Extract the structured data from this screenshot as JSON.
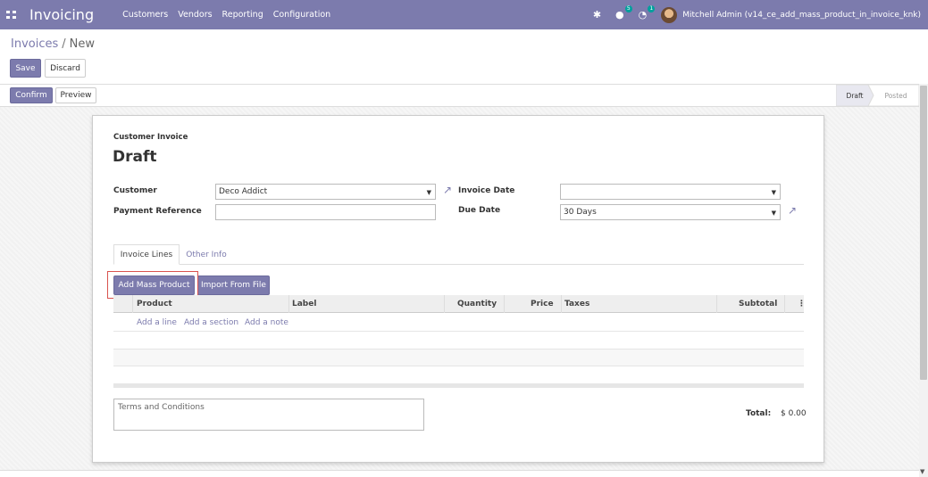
{
  "navbar": {
    "app_title": "Invoicing",
    "menu": [
      "Customers",
      "Vendors",
      "Reporting",
      "Configuration"
    ],
    "icons": [
      "bug-icon",
      "chat-icon",
      "clock-icon"
    ],
    "chat_count": "5",
    "activity_count": "1",
    "user": "Mitchell Admin (v14_ce_add_mass_product_in_invoice_knk)"
  },
  "breadcrumb": {
    "parent": "Invoices",
    "separator": "/",
    "current": "New"
  },
  "buttons": {
    "save": "Save",
    "discard": "Discard",
    "confirm": "Confirm",
    "preview": "Preview"
  },
  "status": {
    "draft": "Draft",
    "posted": "Posted"
  },
  "form": {
    "doc_type": "Customer Invoice",
    "state_title": "Draft",
    "customer_label": "Customer",
    "customer_value": "Deco Addict",
    "payment_ref_label": "Payment Reference",
    "payment_ref_value": "",
    "invoice_date_label": "Invoice Date",
    "invoice_date_value": "",
    "due_date_label": "Due Date",
    "due_date_value": "30 Days"
  },
  "tabs": {
    "lines": "Invoice Lines",
    "other": "Other Info"
  },
  "line_buttons": {
    "mass": "Add Mass Product",
    "import": "Import From File"
  },
  "table": {
    "headers": {
      "product": "Product",
      "label": "Label",
      "quantity": "Quantity",
      "price": "Price",
      "taxes": "Taxes",
      "subtotal": "Subtotal"
    },
    "add_line": "Add a line",
    "add_section": "Add a section",
    "add_note": "Add a note"
  },
  "footer": {
    "terms_placeholder": "Terms and Conditions",
    "total_label": "Total:",
    "total_value": "$ 0.00"
  },
  "colors": {
    "primary": "#7c7bad",
    "badge": "#00a09d",
    "highlight": "#d9534f"
  }
}
